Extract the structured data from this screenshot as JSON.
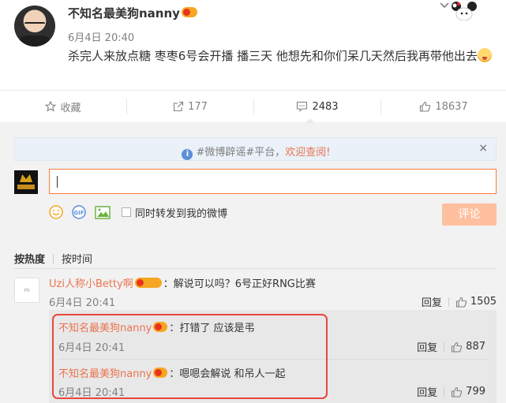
{
  "post": {
    "username": "不知名最美狗nanny",
    "time": "6月4日 20:40",
    "text": "杀完人来放点糖 枣枣6号会开播 播三天 他想先和你们呆几天然后我再带他出去"
  },
  "actions": {
    "favorite_label": "收藏",
    "share_count": "177",
    "comment_count": "2483",
    "like_count": "18637"
  },
  "notice": {
    "text_prefix": "#微博辟谣#平台，",
    "text_highlight": "欢迎查阅!",
    "close": "×",
    "info_glyph": "i"
  },
  "composer": {
    "repost_label": "同时转发到我的微博",
    "submit_label": "评论"
  },
  "sort": {
    "hot_label": "按热度",
    "time_label": "按时间"
  },
  "comments": [
    {
      "avatar_text": "m",
      "name": "Uzi人称小Betty啊",
      "text": "：解说可以吗？6号正好RNG比赛",
      "time": "6月4日 20:41",
      "reply_label": "回复",
      "likes": "1505",
      "replies": [
        {
          "name": "不知名最美狗nanny",
          "text": "：打错了 应该是弔",
          "time": "6月4日 20:41",
          "reply_label": "回复",
          "likes": "887"
        },
        {
          "name": "不知名最美狗nanny",
          "text": "：嗯嗯会解说 和吊人一起",
          "time": "6月4日 20:41",
          "reply_label": "回复",
          "likes": "799"
        }
      ]
    }
  ],
  "colors": {
    "accent": "#eb7350",
    "highlight_box": "#e8473a",
    "input_border": "#fa7d3c",
    "submit_bg": "#ffc09f"
  }
}
